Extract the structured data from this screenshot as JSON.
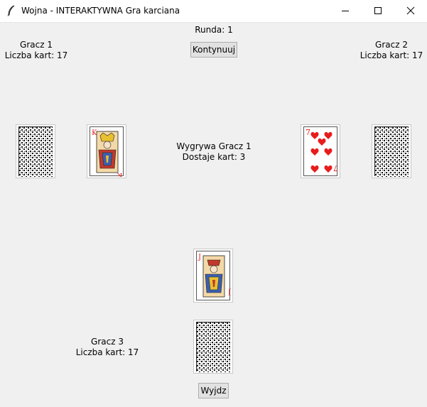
{
  "window": {
    "title": "Wojna - INTERAKTYWNA Gra karciana",
    "icons": {
      "app": "feather-icon",
      "minimize": "minimize-icon",
      "maximize": "maximize-icon",
      "close": "close-icon"
    }
  },
  "round": {
    "label": "Runda: 1"
  },
  "buttons": {
    "continue": "Kontynuuj",
    "quit": "Wyjdz"
  },
  "players": [
    {
      "name": "Gracz 1",
      "cards": "Liczba kart: 17",
      "face_card": {
        "rank": "K",
        "suit": "hearts"
      }
    },
    {
      "name": "Gracz 2",
      "cards": "Liczba kart: 17",
      "face_card": {
        "rank": "7",
        "suit": "hearts"
      }
    },
    {
      "name": "Gracz 3",
      "cards": "Liczba kart: 17",
      "face_card": {
        "rank": "J",
        "suit": "hearts"
      }
    }
  ],
  "result": {
    "winner": "Wygrywa Gracz 1",
    "gain": "Dostaje kart: 3"
  },
  "colors": {
    "background": "#f0f0f0",
    "heart_red": "#e81c1c",
    "titlebar": "#ffffff"
  }
}
